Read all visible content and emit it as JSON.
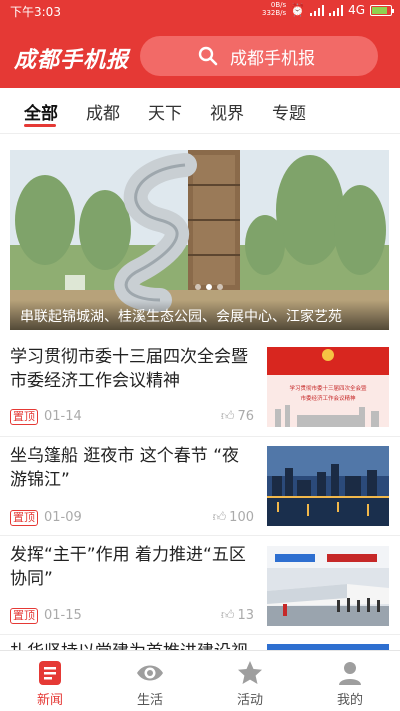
{
  "status_bar": {
    "time": "下午3:03",
    "net_speed_top": "0B/s",
    "net_speed_bottom": "332B/s",
    "network": "4G"
  },
  "header": {
    "app_title": "成都手机报",
    "search_placeholder": "成都手机报"
  },
  "tabs": [
    {
      "label": "全部",
      "active": true
    },
    {
      "label": "成都",
      "active": false
    },
    {
      "label": "天下",
      "active": false
    },
    {
      "label": "视界",
      "active": false
    },
    {
      "label": "专题",
      "active": false
    }
  ],
  "banner": {
    "caption": "串联起锦城湖、桂溪生态公园、会展中心、江家艺苑"
  },
  "news": [
    {
      "title": "学习贯彻市委十三届四次全会暨市委经济工作会议精神",
      "tag": "置顶",
      "date": "01-14",
      "likes": "76",
      "thumb_text_1": "学习贯彻市委十三届四次全会暨",
      "thumb_text_2": "市委经济工作会议精神"
    },
    {
      "title": "坐乌篷船 逛夜市 这个春节 “夜游锦江”",
      "tag": "置顶",
      "date": "01-09",
      "likes": "100"
    },
    {
      "title": "发挥“主干”作用 着力推进“五区协同”",
      "tag": "置顶",
      "date": "01-15",
      "likes": "13"
    },
    {
      "title": "扎华坚持以党建为首推进建设视行"
    }
  ],
  "bottom_nav": [
    {
      "label": "新闻",
      "icon": "news-icon",
      "active": true
    },
    {
      "label": "生活",
      "icon": "eye-icon",
      "active": false
    },
    {
      "label": "活动",
      "icon": "star-icon",
      "active": false
    },
    {
      "label": "我的",
      "icon": "user-icon",
      "active": false
    }
  ],
  "colors": {
    "brand": "#e53935",
    "text": "#222222",
    "muted": "#aaaaaa"
  }
}
